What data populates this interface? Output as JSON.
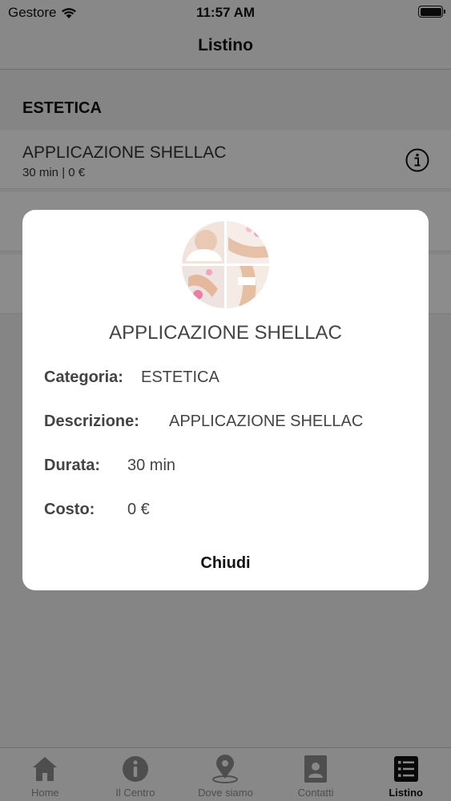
{
  "status_bar": {
    "carrier": "Gestore",
    "time": "11:57 AM"
  },
  "nav": {
    "title": "Listino"
  },
  "list": {
    "section_title": "ESTETICA",
    "items": [
      {
        "title": "APPLICAZIONE SHELLAC",
        "subtitle": "30 min | 0 €"
      }
    ]
  },
  "dialog": {
    "title": "APPLICAZIONE SHELLAC",
    "fields": {
      "categoria": {
        "label": "Categoria:",
        "value": "ESTETICA"
      },
      "descrizione": {
        "label": "Descrizione:",
        "value": "APPLICAZIONE SHELLAC"
      },
      "durata": {
        "label": "Durata:",
        "value": "30 min"
      },
      "costo": {
        "label": "Costo:",
        "value": "0 €"
      }
    },
    "close_label": "Chiudi"
  },
  "tabs": [
    {
      "label": "Home",
      "icon": "home-icon",
      "active": false
    },
    {
      "label": "Il Centro",
      "icon": "info-icon",
      "active": false
    },
    {
      "label": "Dove siamo",
      "icon": "location-pin-icon",
      "active": false
    },
    {
      "label": "Contatti",
      "icon": "contact-card-icon",
      "active": false
    },
    {
      "label": "Listino",
      "icon": "list-icon",
      "active": true
    }
  ]
}
